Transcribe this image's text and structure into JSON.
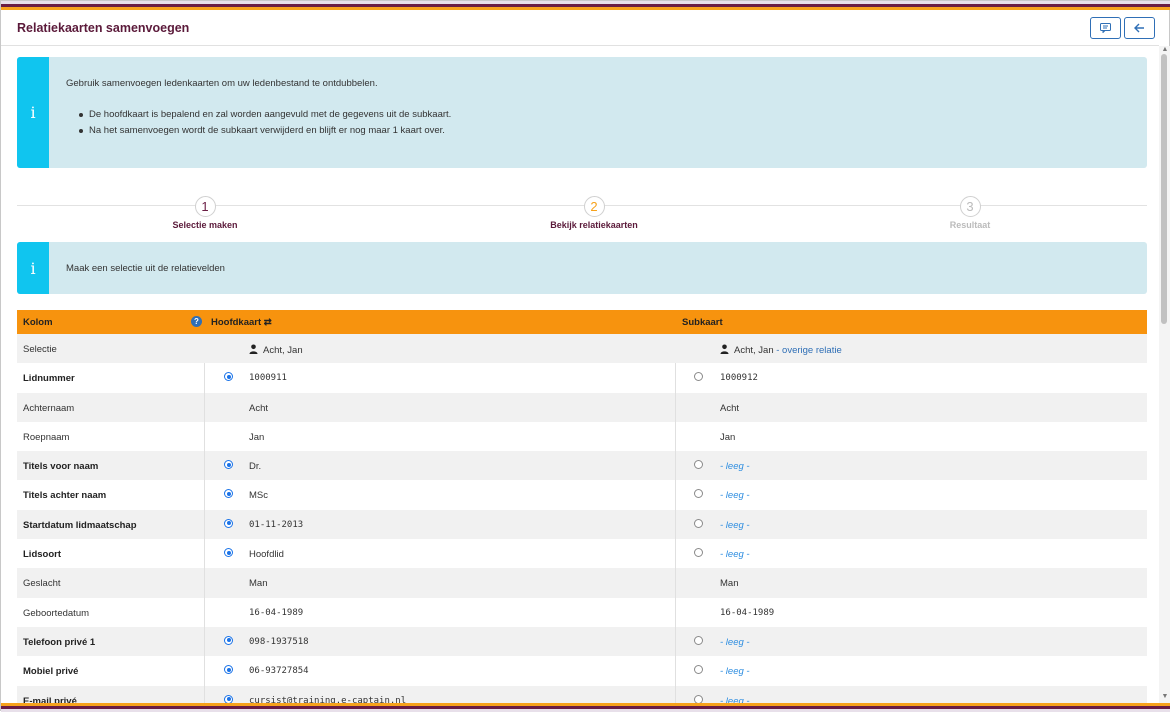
{
  "header": {
    "title": "Relatiekaarten samenvoegen",
    "btn_comment_icon": "comment-icon",
    "btn_back_icon": "arrow-left-icon"
  },
  "info1": {
    "intro": "Gebruik samenvoegen ledenkaarten om uw ledenbestand te ontdubbelen.",
    "bullets": [
      "De hoofdkaart is bepalend en zal worden aangevuld met de gegevens uit de subkaart.",
      "Na het samenvoegen wordt de subkaart verwijderd en blijft er nog maar 1 kaart over."
    ]
  },
  "steps": [
    {
      "num": "1",
      "label": "Selectie maken"
    },
    {
      "num": "2",
      "label": "Bekijk relatiekaarten"
    },
    {
      "num": "3",
      "label": "Resultaat"
    }
  ],
  "info2": {
    "text": "Maak een selectie uit de relatievelden"
  },
  "table": {
    "headers": {
      "kolom": "Kolom",
      "help": "?",
      "hoofdkaart": "Hoofdkaart ⇄",
      "subkaart": "Subkaart"
    },
    "selectie": {
      "label": "Selectie",
      "hoofd": "Acht, Jan",
      "sub": "Acht, Jan",
      "sub_link": "- overige relatie"
    },
    "rows": [
      {
        "label": "Lidnummer",
        "hoofd": "1000911",
        "sub": "1000912"
      },
      {
        "label": "Achternaam",
        "hoofd": "Acht",
        "sub": "Acht"
      },
      {
        "label": "Roepnaam",
        "hoofd": "Jan",
        "sub": "Jan"
      },
      {
        "label": "Titels voor naam",
        "hoofd": "Dr.",
        "sub": "- leeg -"
      },
      {
        "label": "Titels achter naam",
        "hoofd": "MSc",
        "sub": "- leeg -"
      },
      {
        "label": "Startdatum lidmaatschap",
        "hoofd": "01-11-2013",
        "sub": "- leeg -"
      },
      {
        "label": "Lidsoort",
        "hoofd": "Hoofdlid",
        "sub": "- leeg -"
      },
      {
        "label": "Geslacht",
        "hoofd": "Man",
        "sub": "Man"
      },
      {
        "label": "Geboortedatum",
        "hoofd": "16-04-1989",
        "sub": "16-04-1989"
      },
      {
        "label": "Telefoon privé 1",
        "hoofd": "098-1937518",
        "sub": "- leeg -"
      },
      {
        "label": "Mobiel privé",
        "hoofd": "06-93727854",
        "sub": "- leeg -"
      },
      {
        "label": "E-mail privé",
        "hoofd": "cursist@training.e-captain.nl",
        "sub": "- leeg -"
      }
    ]
  }
}
